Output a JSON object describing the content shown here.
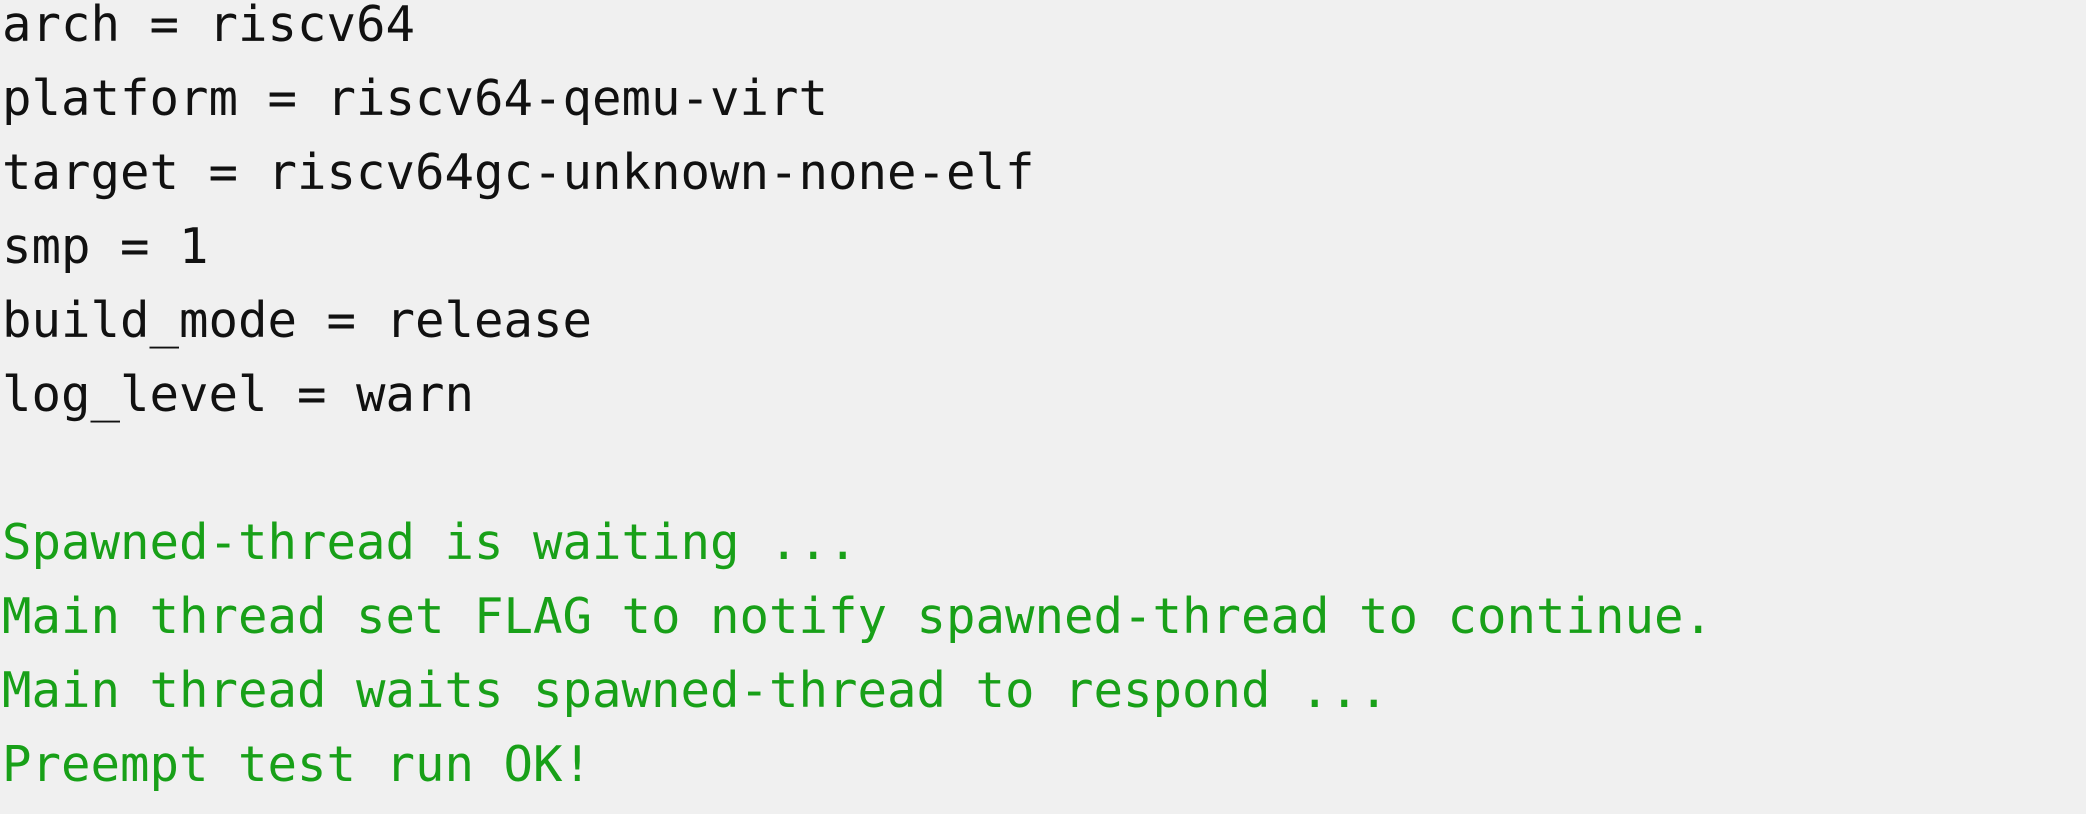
{
  "colors": {
    "background": "#f0f0f0",
    "config_text": "#111111",
    "output_text": "#18a018"
  },
  "config_lines": [
    "arch = riscv64",
    "platform = riscv64-qemu-virt",
    "target = riscv64gc-unknown-none-elf",
    "smp = 1",
    "build_mode = release",
    "log_level = warn"
  ],
  "output_lines": [
    "Spawned-thread is waiting ...",
    "Main thread set FLAG to notify spawned-thread to continue.",
    "Main thread waits spawned-thread to respond ...",
    "Preempt test run OK!"
  ]
}
